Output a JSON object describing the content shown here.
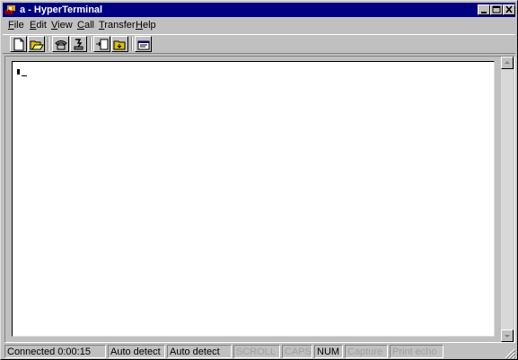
{
  "window": {
    "title": "a - HyperTerminal"
  },
  "menu": {
    "items": [
      {
        "accel": "F",
        "rest": "ile"
      },
      {
        "accel": "E",
        "rest": "dit"
      },
      {
        "accel": "V",
        "rest": "iew"
      },
      {
        "accel": "C",
        "rest": "all"
      },
      {
        "accel": "T",
        "rest": "ransfer"
      },
      {
        "accel": "H",
        "rest": "elp"
      }
    ]
  },
  "toolbar": {
    "buttons": [
      "new-connection-icon",
      "open-icon",
      "connect-icon",
      "disconnect-icon",
      "send-icon",
      "receive-icon",
      "properties-icon"
    ]
  },
  "terminal": {
    "content": ""
  },
  "status": {
    "connected": "Connected 0:00:15",
    "detect1": "Auto detect",
    "detect2": "Auto detect",
    "scroll": "SCROLL",
    "caps": "CAPS",
    "num": "NUM",
    "capture": "Capture",
    "print_echo": "Print echo"
  },
  "colors": {
    "titlebar": "#000080",
    "face": "#c0c0c0",
    "terminal_bg": "#ffffff"
  }
}
